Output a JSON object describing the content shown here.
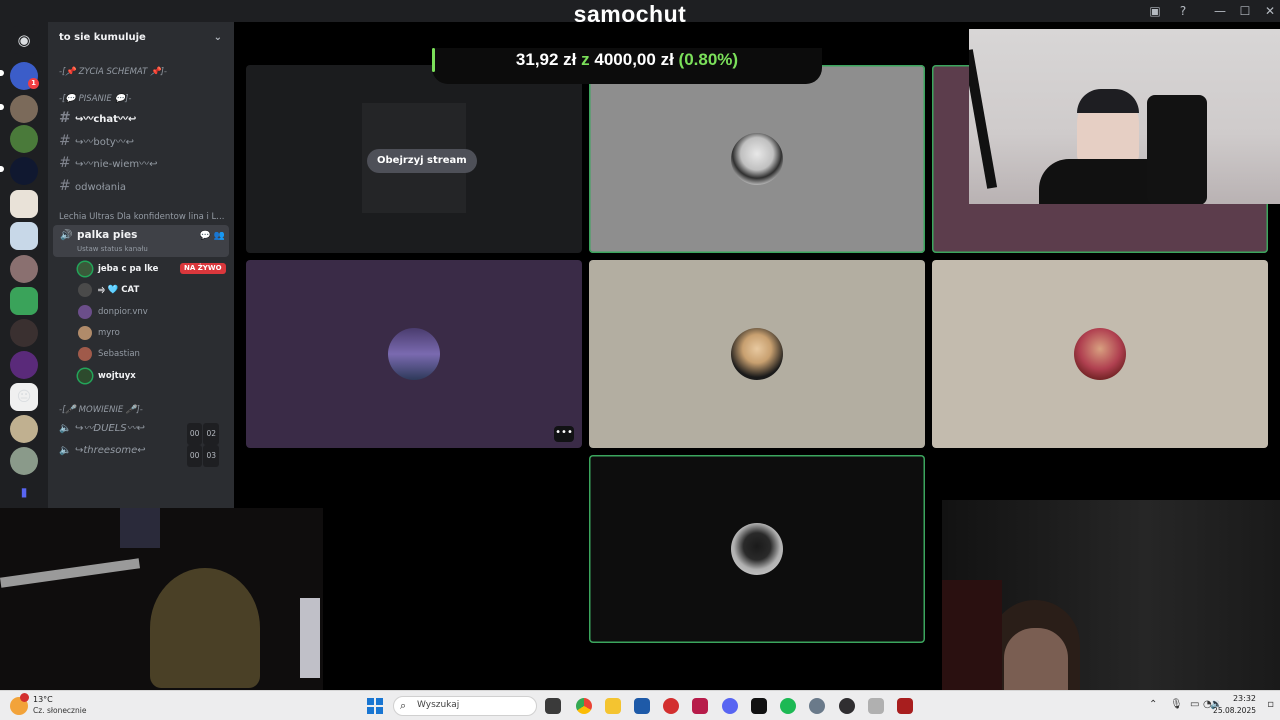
{
  "window": {
    "title": "samochut"
  },
  "server": {
    "name": "to sie kumuluje"
  },
  "categories": {
    "zycia": "-[📌 ZYCIA SCHEMAT 📌]-",
    "pisanie": "-[💬 PISANIE 💬]-",
    "lechia": "Lechia Ultras Dla konfidentow lina i L...",
    "mowienie": "-[🎤 MOWIENIE 🎤]-"
  },
  "text_channels": [
    {
      "name": "↪︎〰chat〰↩︎",
      "unread": true
    },
    {
      "name": "↪︎〰boty〰↩︎",
      "unread": false
    },
    {
      "name": "↪︎〰nie-wiem〰↩︎",
      "unread": false
    },
    {
      "name": "odwołania",
      "unread": false
    }
  ],
  "active_voice": {
    "name": "palka pies",
    "status": "Ustaw status kanału",
    "live_badge": "NA ŻYWO",
    "members": [
      {
        "name": "jeba c pa lke",
        "live": true,
        "bright": true,
        "color": "#3a5a3a"
      },
      {
        "name": "⥤ 🩵 CAT",
        "live": false,
        "bright": true,
        "color": "#4a4a4a"
      },
      {
        "name": "donpior.vnv",
        "live": false,
        "bright": false,
        "color": "#6b4e8a"
      },
      {
        "name": "myro",
        "live": false,
        "bright": false,
        "color": "#b08b6a"
      },
      {
        "name": "Sebastian",
        "live": false,
        "bright": false,
        "color": "#a05a4a"
      },
      {
        "name": "wojtuyx",
        "live": false,
        "bright": true,
        "color": "#2d4a2d"
      }
    ]
  },
  "voice_channels": [
    {
      "name": "↪︎〰DUELS〰↩︎",
      "count_a": "00",
      "count_b": "02"
    },
    {
      "name": "↪︎threesome↩︎",
      "count_a": "00",
      "count_b": "03"
    }
  ],
  "stage": {
    "watch_stream": "Obejrzyj stream",
    "more": "•••"
  },
  "donation": {
    "current": "31,92 zł",
    "sep": "z",
    "goal": "4000,00 zł",
    "percent": "(0.80%)",
    "progress_fraction": 0.008
  },
  "taskbar": {
    "weather_temp": "13°C",
    "weather_desc": "Cz. słonecznie",
    "search_placeholder": "Wyszukaj",
    "time": "23:32",
    "date": "25.08.2025"
  },
  "colors": {
    "speaking": "#3ba55d",
    "live": "#da373c",
    "goal_green": "#7be05a"
  }
}
